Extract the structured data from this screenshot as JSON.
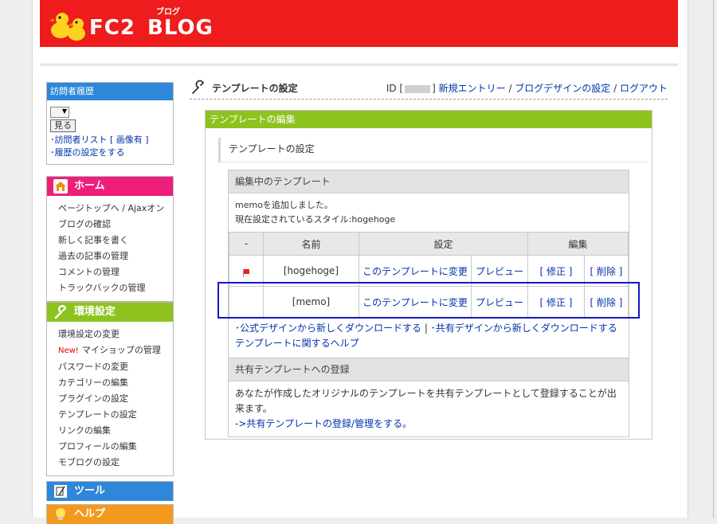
{
  "header": {
    "logo_text": "FC2",
    "logo_blog": "BLOG",
    "logo_kana": "ブログ"
  },
  "sidebar": {
    "visitor": {
      "title": "訪問者履歴",
      "view_button": "見る",
      "links": [
        "･訪問者リスト [ 画像有 ]",
        "･履歴の設定をする"
      ]
    },
    "home": {
      "title": "ホーム",
      "items": [
        "ページトップへ / Ajaxオン",
        "ブログの確認",
        "新しく記事を書く",
        "過去の記事の管理",
        "コメントの管理",
        "トラックバックの管理"
      ]
    },
    "settings": {
      "title": "環境設定",
      "new_tag": "New!",
      "items": [
        "環境設定の変更",
        "マイショップの管理",
        "パスワードの変更",
        "カテゴリーの編集",
        "プラグインの設定",
        "テンプレートの設定",
        "リンクの編集",
        "プロフィールの編集",
        "モブログの設定"
      ]
    },
    "tools": {
      "title": "ツール"
    },
    "help": {
      "title": "ヘルプ"
    }
  },
  "main": {
    "title": "テンプレートの設定",
    "id_label": "ID [",
    "id_close": "]",
    "links": [
      "新規エントリー",
      "ブログデザインの設定",
      "ログアウト"
    ],
    "separator": " / ",
    "panel_title": "テンプレートの編集",
    "section_label": "テンプレートの設定",
    "editing": {
      "title": "編集中のテンプレート",
      "message1": "memoを追加しました。",
      "message2": "現在設定されているスタイル:hogehoge",
      "headers": [
        "-",
        "名前",
        "設定",
        "編集"
      ],
      "rows": [
        {
          "name": "[hogehoge]",
          "apply": "このテンプレートに変更",
          "preview": "プレビュー",
          "edit": "[ 修正 ]",
          "delete": "[ 削除 ]"
        },
        {
          "name": "[memo]",
          "apply": "このテンプレートに変更",
          "preview": "プレビュー",
          "edit": "[ 修正 ]",
          "delete": "[ 削除 ]"
        }
      ],
      "download_official": "･公式デザインから新しくダウンロードする",
      "download_sep": " | ",
      "download_shared": "･共有デザインから新しくダウンロードする",
      "help_link": "テンプレートに関するヘルプ"
    },
    "shared": {
      "title": "共有テンプレートへの登録",
      "desc": "あなたが作成したオリジナルのテンプレートを共有テンプレートとして登録することが出来ます。",
      "link": "->共有テンプレートの登録/管理をする。"
    }
  },
  "colors": {
    "header_red": "#ee1c1c",
    "visitor_blue": "#2e87d8",
    "home_pink": "#ee1f7a",
    "settings_green": "#8ec31f",
    "tools_blue": "#2e87d8",
    "help_orange": "#f39a1e",
    "highlight_box": "#1616c8"
  }
}
